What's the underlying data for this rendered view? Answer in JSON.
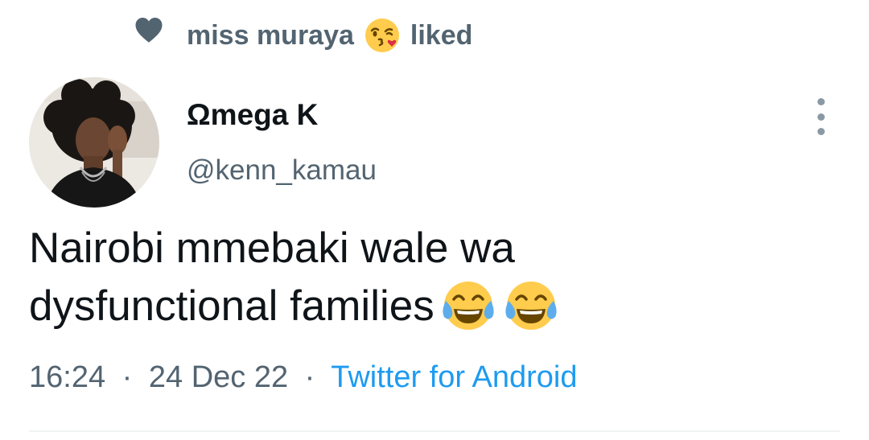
{
  "social_context": {
    "icon": "heart-icon",
    "user": "miss muraya",
    "emoji": "face-blowing-a-kiss",
    "action": "liked"
  },
  "tweet": {
    "author": {
      "display_name": "Ωmega K",
      "handle": "@kenn_kamau"
    },
    "text_line1": "Nairobi mmebaki wale wa",
    "text_line2": "dysfunctional families",
    "text_emojis": [
      "face-with-tears-of-joy",
      "face-with-tears-of-joy"
    ],
    "time": "16:24",
    "date": "24 Dec 22",
    "source": "Twitter for Android",
    "separator": "·"
  },
  "colors": {
    "primary_text": "#0f1419",
    "secondary_text": "#536471",
    "link": "#1d9bf0",
    "divider": "#eff3f4"
  }
}
